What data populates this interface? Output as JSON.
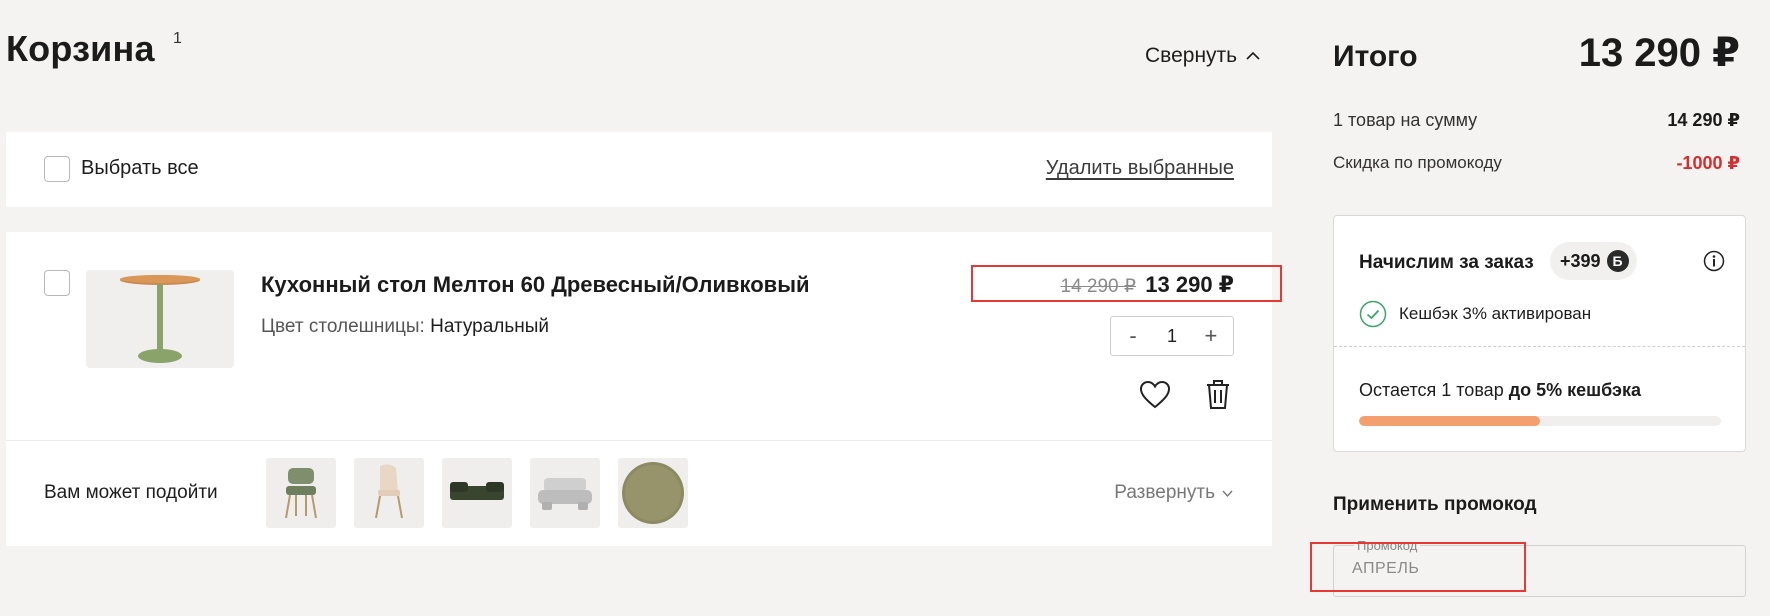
{
  "cart": {
    "title": "Корзина",
    "count": "1",
    "collapse_label": "Свернуть"
  },
  "select_panel": {
    "select_all_label": "Выбрать все",
    "delete_selected_label": "Удалить выбранные"
  },
  "item": {
    "name": "Кухонный стол Мелтон 60 Древесный/Оливковый",
    "attr_label": "Цвет столешницы:",
    "attr_value": "Натуральный",
    "old_price": "14 290 ₽",
    "new_price": "13 290 ₽",
    "quantity": "1",
    "minus": "-",
    "plus": "+",
    "image_icon": "round-table-image"
  },
  "suggestions": {
    "label": "Вам может подойти",
    "expand_label": "Развернуть",
    "items": [
      "green-chair-thumb",
      "beige-chair-thumb",
      "dark-sofa-thumb",
      "grey-bench-thumb",
      "round-rug-thumb"
    ]
  },
  "summary": {
    "total_label": "Итого",
    "total_value": "13 290 ₽",
    "sum_label": "1 товар на сумму",
    "sum_value": "14 290 ₽",
    "discount_label": "Скидка по промокоду",
    "discount_value": "-1000 ₽"
  },
  "bonus": {
    "title": "Начислим за заказ",
    "amount": "+399",
    "currency_symbol": "Б",
    "cashback_text": "Кешбэк 3% активирован",
    "remain_text": "Остается 1 товар",
    "remain_bold": "до 5% кешбэка",
    "progress_fraction": 0.5
  },
  "promo": {
    "title": "Применить промокод",
    "legend": "Промокод",
    "value": "АПРЕЛЬ"
  },
  "colors": {
    "background": "#f4f3f1",
    "accent_orange": "#f4a06e",
    "discount_red": "#d32f2f",
    "highlight_red": "#e53935",
    "check_green": "#3aa66a"
  }
}
